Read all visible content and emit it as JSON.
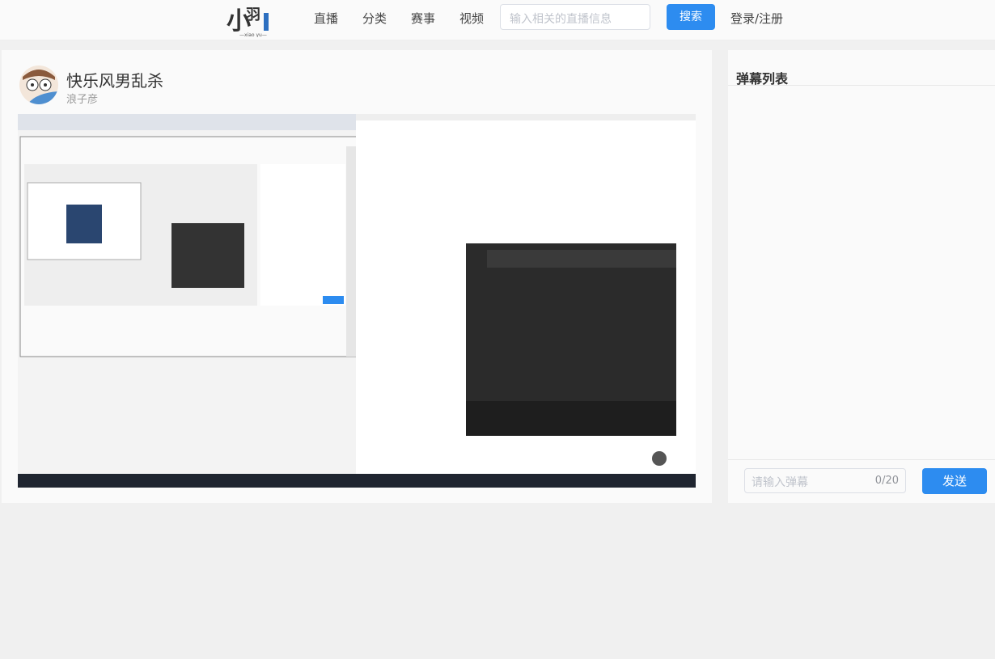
{
  "header": {
    "logo_text": "小羽",
    "logo_sub": "xiao yu",
    "nav": [
      "直播",
      "分类",
      "赛事",
      "视频"
    ],
    "search_placeholder": "输入相关的直播信息",
    "search_button": "搜索",
    "login": "登录/注册"
  },
  "room": {
    "title": "快乐风男乱杀",
    "anchor": "浪子彦"
  },
  "danmaku": {
    "title": "弹幕列表",
    "input_placeholder": "请输入弹幕",
    "count": "0/20",
    "send": "发送"
  },
  "colors": {
    "accent": "#2d8cf0"
  }
}
